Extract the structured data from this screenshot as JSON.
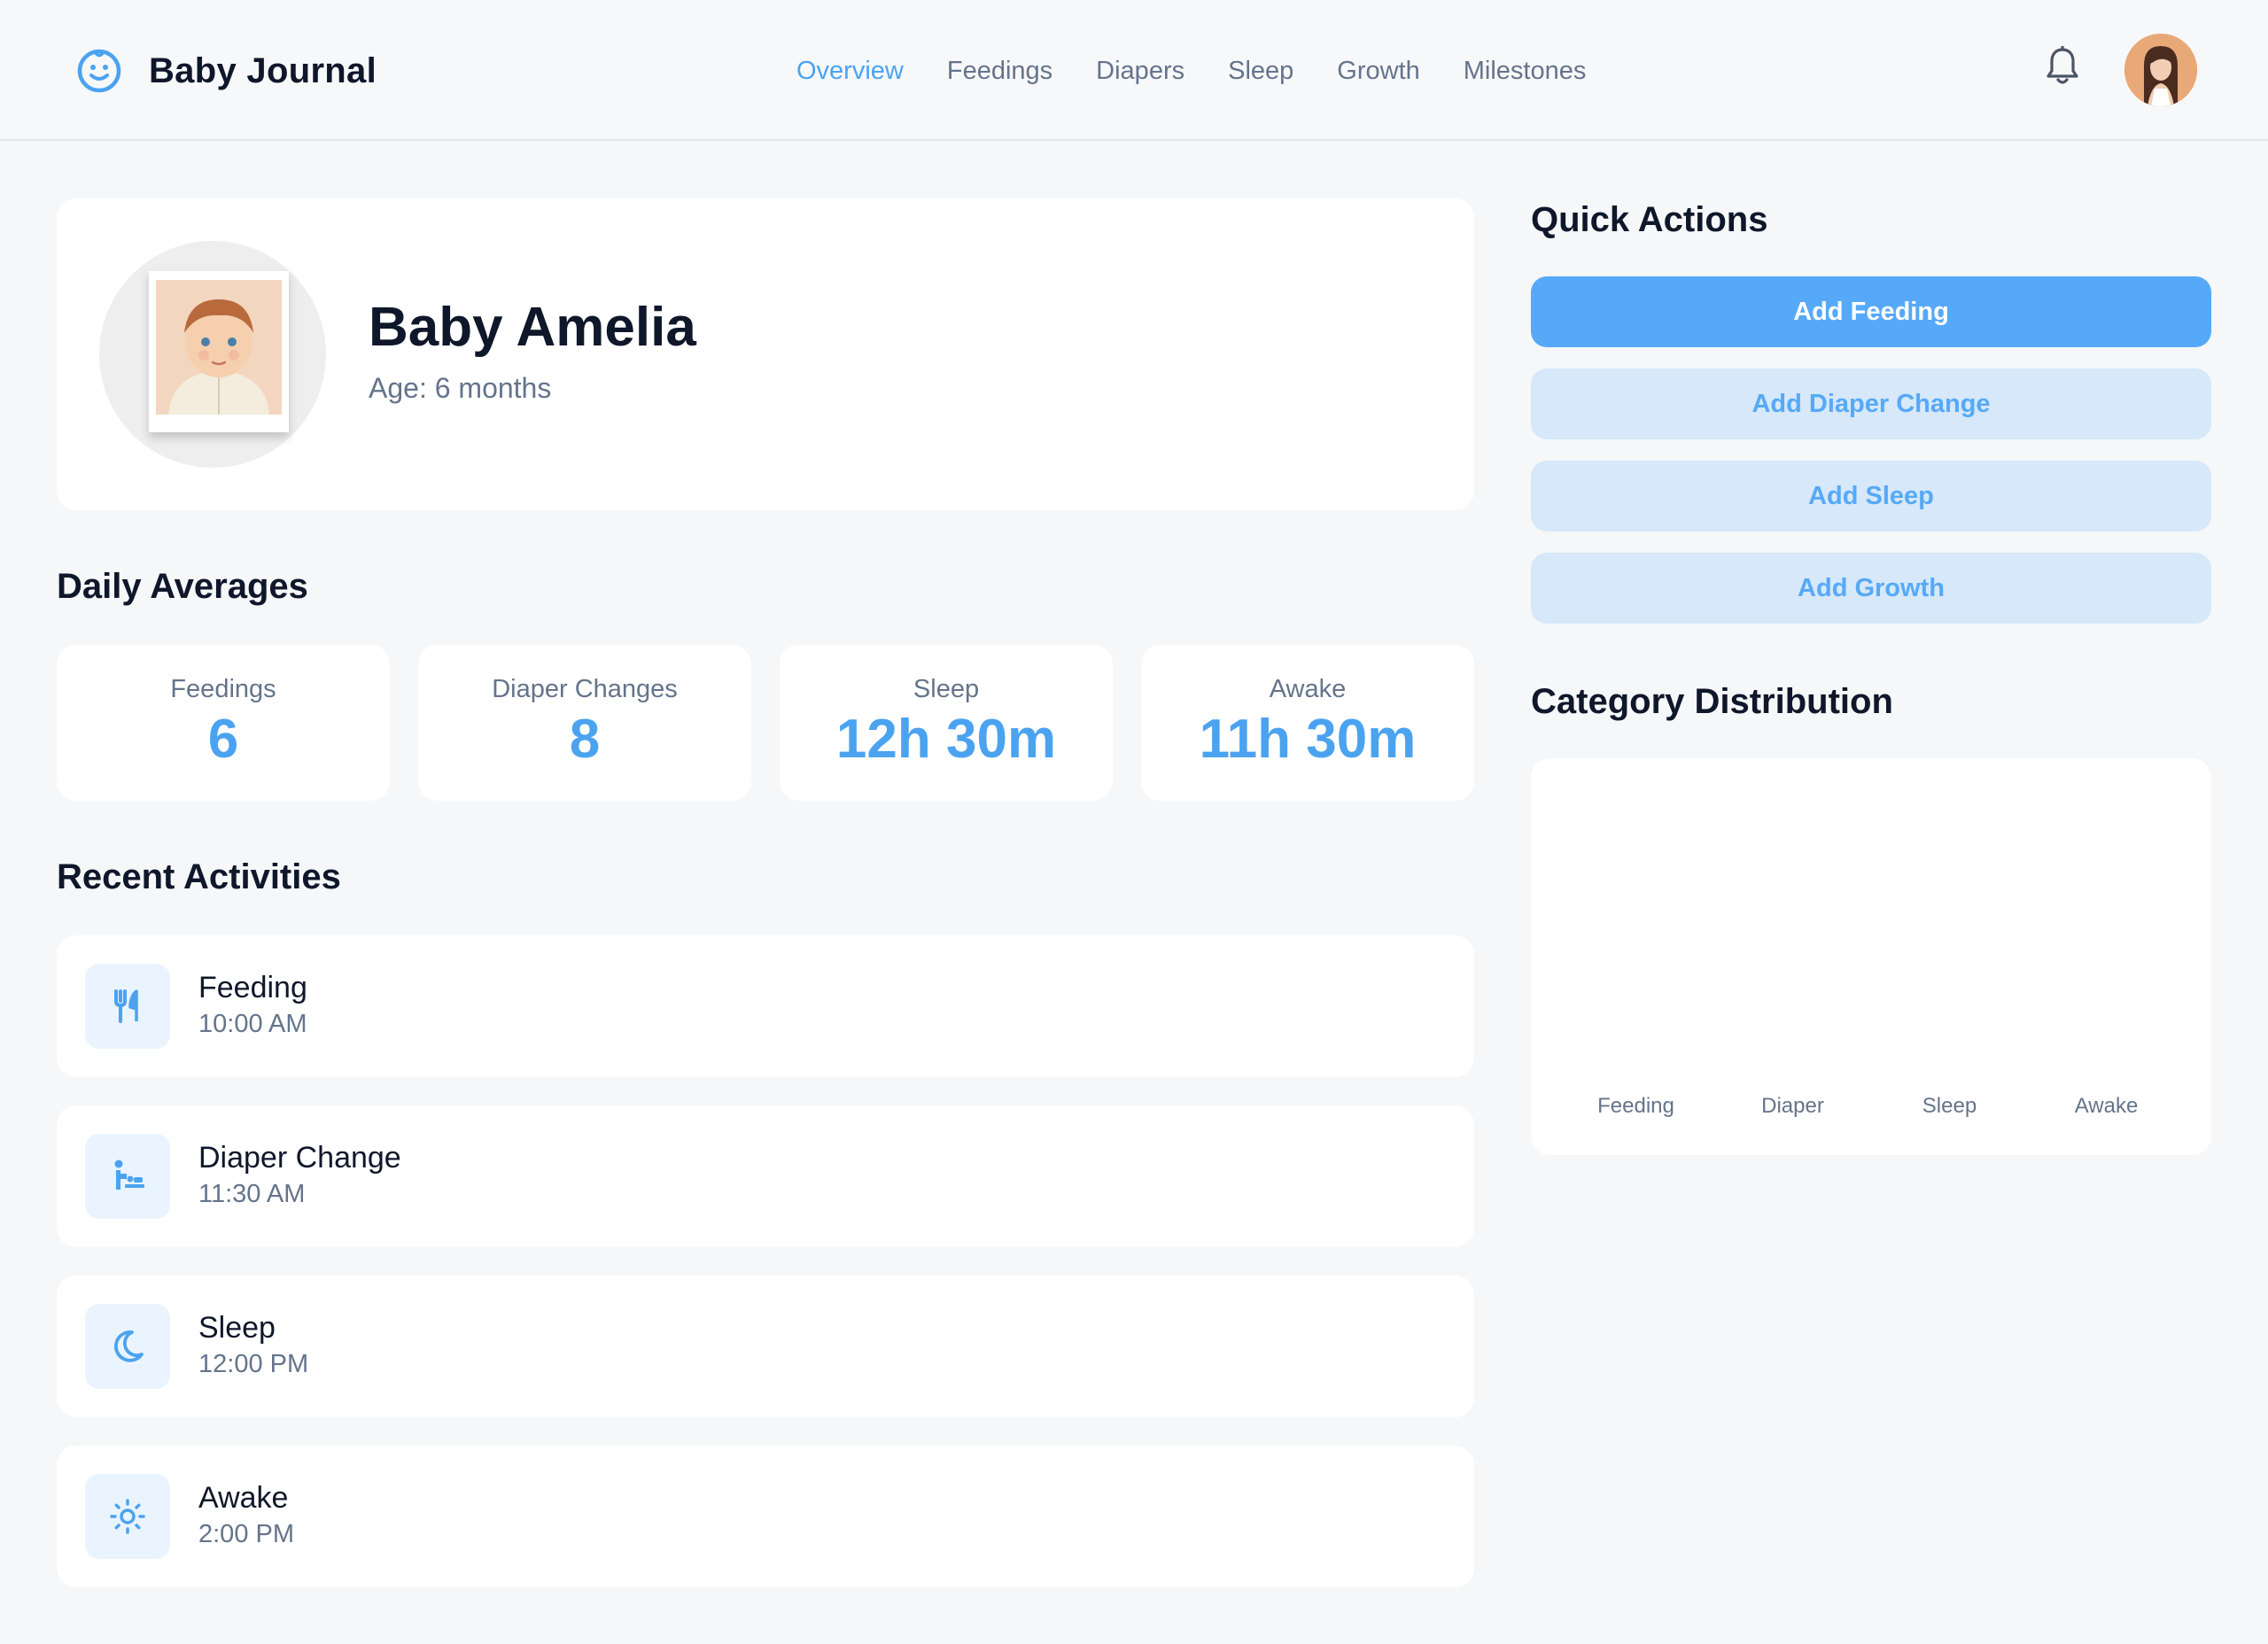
{
  "app": {
    "title": "Baby Journal",
    "brand_icon": "baby-face-icon"
  },
  "nav": {
    "items": [
      {
        "label": "Overview",
        "active": true
      },
      {
        "label": "Feedings",
        "active": false
      },
      {
        "label": "Diapers",
        "active": false
      },
      {
        "label": "Sleep",
        "active": false
      },
      {
        "label": "Growth",
        "active": false
      },
      {
        "label": "Milestones",
        "active": false
      }
    ]
  },
  "header": {
    "notification_icon": "bell-icon",
    "avatar_icon": "user-avatar"
  },
  "profile": {
    "name": "Baby Amelia",
    "age": "Age: 6 months"
  },
  "daily_averages": {
    "title": "Daily Averages",
    "stats": [
      {
        "label": "Feedings",
        "value": "6"
      },
      {
        "label": "Diaper Changes",
        "value": "8"
      },
      {
        "label": "Sleep",
        "value": "12h 30m"
      },
      {
        "label": "Awake",
        "value": "11h 30m"
      }
    ]
  },
  "recent_activities": {
    "title": "Recent Activities",
    "items": [
      {
        "title": "Feeding",
        "time": "10:00 AM",
        "icon": "utensils-icon"
      },
      {
        "title": "Diaper Change",
        "time": "11:30 AM",
        "icon": "baby-changing-icon"
      },
      {
        "title": "Sleep",
        "time": "12:00 PM",
        "icon": "moon-icon"
      },
      {
        "title": "Awake",
        "time": "2:00 PM",
        "icon": "sun-icon"
      }
    ]
  },
  "quick_actions": {
    "title": "Quick Actions",
    "buttons": [
      {
        "label": "Add Feeding",
        "primary": true
      },
      {
        "label": "Add Diaper Change",
        "primary": false
      },
      {
        "label": "Add Sleep",
        "primary": false
      },
      {
        "label": "Add Growth",
        "primary": false
      }
    ]
  },
  "category_distribution": {
    "title": "Category Distribution"
  },
  "colors": {
    "accent": "#4ba3f0",
    "accent_light": "#d6e8f9",
    "muted_text": "#64748b",
    "background": "#f5f7f9"
  },
  "chart_data": {
    "type": "bar",
    "title": "Category Distribution",
    "categories": [
      "Feeding",
      "Diaper",
      "Sleep",
      "Awake"
    ],
    "values": [],
    "xlabel": "",
    "ylabel": ""
  }
}
